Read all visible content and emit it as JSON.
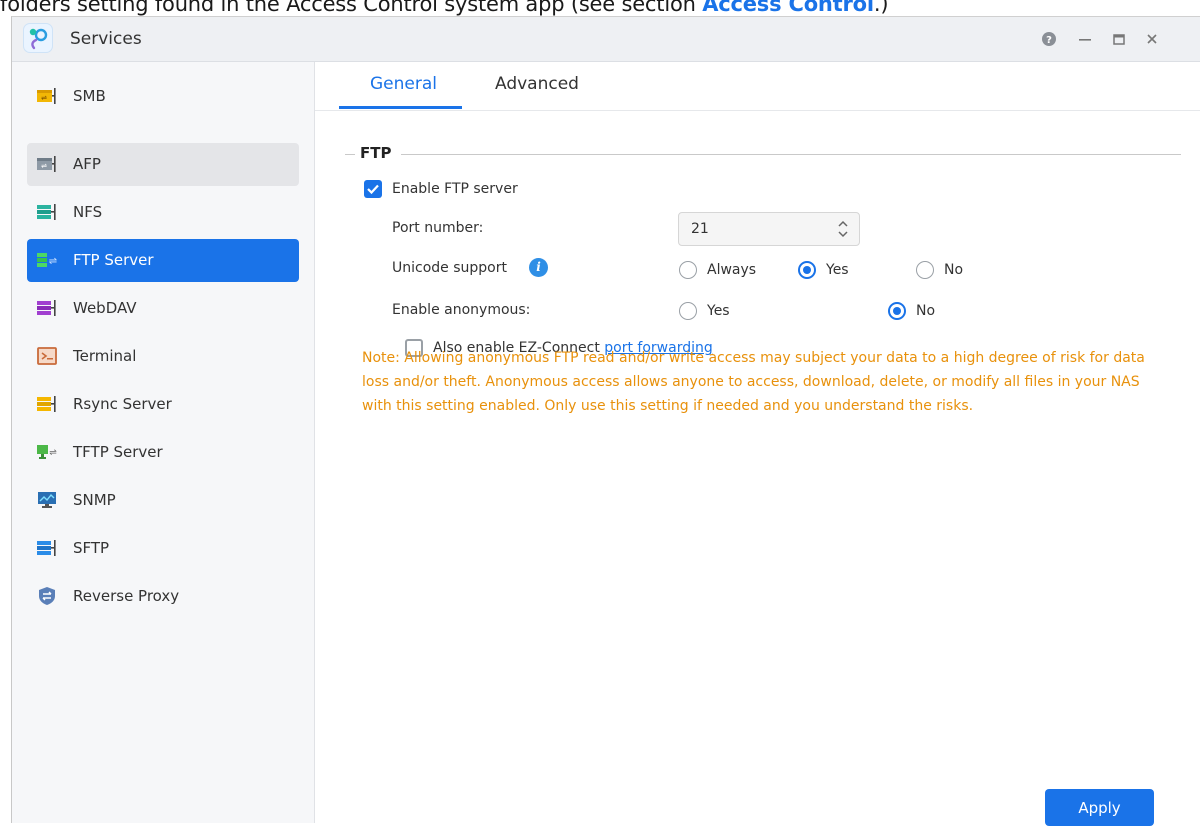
{
  "caption": {
    "text": "folders setting found in the Access Control system app (see section ",
    "link": "Access Control",
    "tail": ".)"
  },
  "window": {
    "title": "Services",
    "controls": [
      "help-icon",
      "minimize-icon",
      "maximize-icon",
      "close-icon"
    ]
  },
  "sidebar": {
    "items": [
      {
        "label": "SMB",
        "icon": "smb-icon",
        "state": "normal"
      },
      {
        "label": "AFP",
        "icon": "afp-icon",
        "state": "hover"
      },
      {
        "label": "NFS",
        "icon": "nfs-icon",
        "state": "normal"
      },
      {
        "label": "FTP Server",
        "icon": "ftp-server-icon",
        "state": "active"
      },
      {
        "label": "WebDAV",
        "icon": "webdav-icon",
        "state": "normal"
      },
      {
        "label": "Terminal",
        "icon": "terminal-icon",
        "state": "normal"
      },
      {
        "label": "Rsync Server",
        "icon": "rsync-server-icon",
        "state": "normal"
      },
      {
        "label": "TFTP Server",
        "icon": "tftp-server-icon",
        "state": "normal"
      },
      {
        "label": "SNMP",
        "icon": "snmp-icon",
        "state": "normal"
      },
      {
        "label": "SFTP",
        "icon": "sftp-icon",
        "state": "normal"
      },
      {
        "label": "Reverse Proxy",
        "icon": "reverse-proxy-icon",
        "state": "normal"
      }
    ]
  },
  "tabs": {
    "general": "General",
    "advanced": "Advanced",
    "active": "General"
  },
  "ftp": {
    "legend": "FTP",
    "enable_label": "Enable FTP server",
    "enable_checked": true,
    "port_label": "Port number:",
    "port_value": "21",
    "unicode_label": "Unicode support",
    "unicode_options": [
      "Always",
      "Yes",
      "No"
    ],
    "unicode_selected": "Yes",
    "anon_label": "Enable anonymous:",
    "anon_options": [
      "Yes",
      "No"
    ],
    "anon_selected": "No",
    "ez_label": "Also enable EZ-Connect ",
    "ez_link": "port forwarding",
    "ez_checked": false,
    "note": "Note: Allowing anonymous FTP read and/or write access may subject your data to a high degree of risk for data loss and/or theft. Anonymous access allows anyone to access, download, delete, or modify all files in your NAS with this setting enabled. Only use this setting if needed and you understand the risks."
  },
  "actions": {
    "apply": "Apply"
  },
  "colors": {
    "accent": "#1a73e8",
    "note": "#e8910c"
  }
}
